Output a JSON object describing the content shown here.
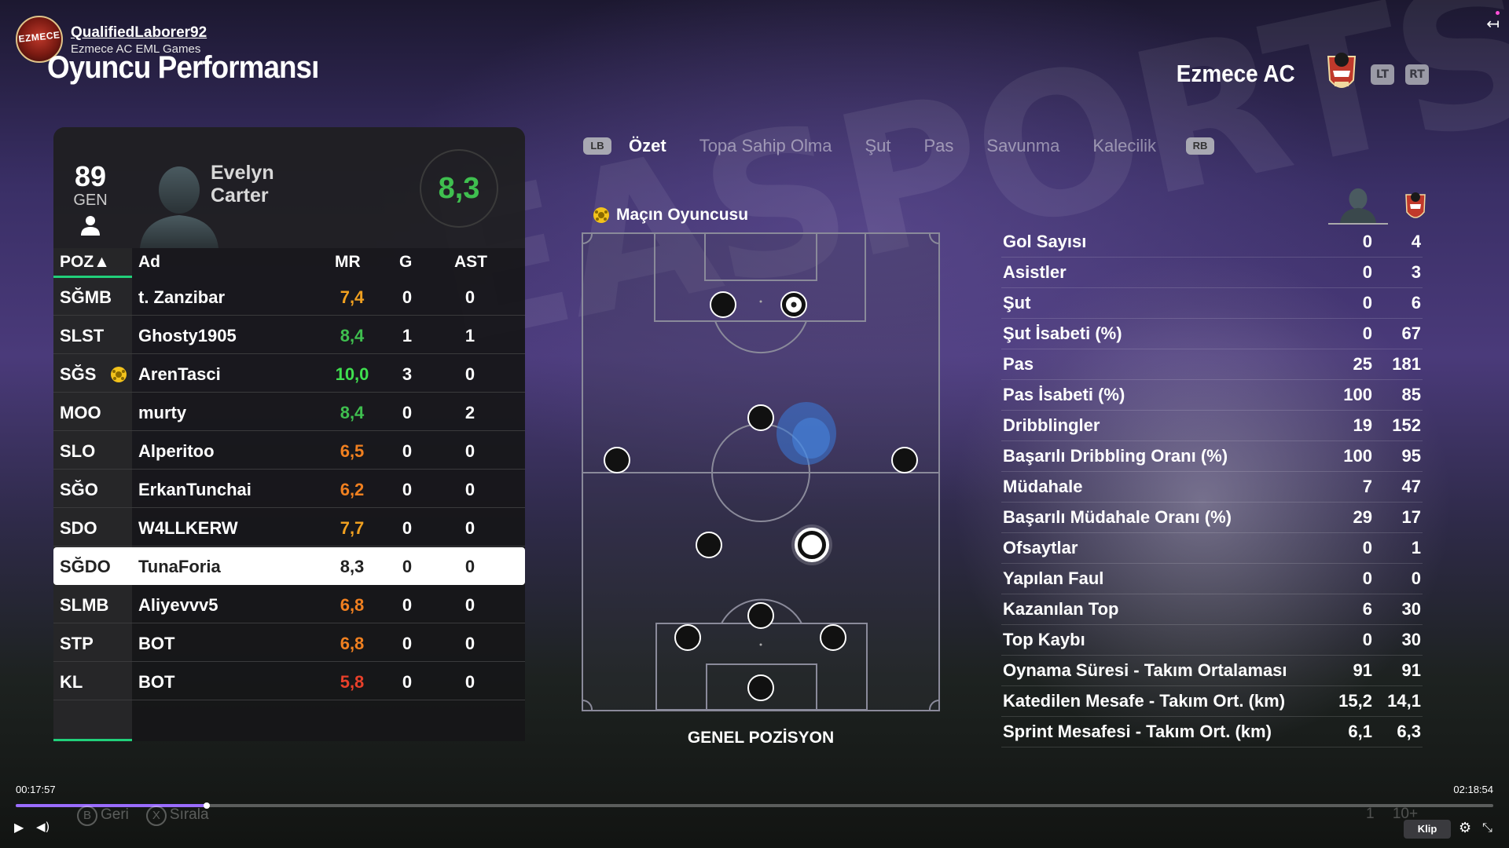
{
  "channel": {
    "logo_text": "EZMECE",
    "name": "QualifiedLaborer92",
    "subtitle": "Ezmece AC EML Games"
  },
  "page_title": "Oyuncu Performansı",
  "team": {
    "name": "Ezmece AC",
    "trigger_left": "LT",
    "trigger_right": "RT"
  },
  "player_card": {
    "overall": "89",
    "overall_label": "GEN",
    "first_name": "Evelyn",
    "last_name": "Carter",
    "match_rating": "8,3",
    "rating_color": "#3fbf4f"
  },
  "table": {
    "headers": {
      "pos": "POZ▲",
      "name": "Ad",
      "mr": "MR",
      "g": "G",
      "ast": "AST"
    },
    "rows": [
      {
        "pos": "SĞMB",
        "name": "t. Zanzibar",
        "mr": "7,4",
        "g": "0",
        "ast": "0",
        "mr_color": "#f0a020"
      },
      {
        "pos": "SLST",
        "name": "Ghosty1905",
        "mr": "8,4",
        "g": "1",
        "ast": "1",
        "mr_color": "#3fbf4f"
      },
      {
        "pos": "SĞS",
        "name": "ArenTasci",
        "mr": "10,0",
        "g": "3",
        "ast": "0",
        "mr_color": "#3fdf4f",
        "motm": true
      },
      {
        "pos": "MOO",
        "name": "murty",
        "mr": "8,4",
        "g": "0",
        "ast": "2",
        "mr_color": "#3fbf4f"
      },
      {
        "pos": "SLO",
        "name": "Alperitoo",
        "mr": "6,5",
        "g": "0",
        "ast": "0",
        "mr_color": "#f08020"
      },
      {
        "pos": "SĞO",
        "name": "ErkanTunchai",
        "mr": "6,2",
        "g": "0",
        "ast": "0",
        "mr_color": "#f08020"
      },
      {
        "pos": "SDO",
        "name": "W4LLKERW",
        "mr": "7,7",
        "g": "0",
        "ast": "0",
        "mr_color": "#f0a020"
      },
      {
        "pos": "SĞDO",
        "name": "TunaForia",
        "mr": "8,3",
        "g": "0",
        "ast": "0",
        "mr_color": "#222222",
        "selected": true
      },
      {
        "pos": "SLMB",
        "name": "Aliyevvv5",
        "mr": "6,8",
        "g": "0",
        "ast": "0",
        "mr_color": "#f08020"
      },
      {
        "pos": "STP",
        "name": "BOT",
        "mr": "6,8",
        "g": "0",
        "ast": "0",
        "mr_color": "#f08020"
      },
      {
        "pos": "KL",
        "name": "BOT",
        "mr": "5,8",
        "g": "0",
        "ast": "0",
        "mr_color": "#e8402a"
      }
    ]
  },
  "tabs": {
    "bumper_left": "LB",
    "bumper_right": "RB",
    "items": [
      "Özet",
      "Topa Sahip Olma",
      "Şut",
      "Pas",
      "Savunma",
      "Kalecilik"
    ],
    "active": "Özet"
  },
  "pitch": {
    "motm_label": "Maçın Oyuncusu",
    "caption": "GENEL POZİSYON"
  },
  "stats": {
    "rows": [
      {
        "label": "Gol Sayısı",
        "player": "0",
        "team": "4"
      },
      {
        "label": "Asistler",
        "player": "0",
        "team": "3"
      },
      {
        "label": "Şut",
        "player": "0",
        "team": "6"
      },
      {
        "label": "Şut İsabeti (%)",
        "player": "0",
        "team": "67"
      },
      {
        "label": "Pas",
        "player": "25",
        "team": "181"
      },
      {
        "label": "Pas İsabeti (%)",
        "player": "100",
        "team": "85"
      },
      {
        "label": "Dribblingler",
        "player": "19",
        "team": "152"
      },
      {
        "label": "Başarılı Dribbling Oranı (%)",
        "player": "100",
        "team": "95"
      },
      {
        "label": "Müdahale",
        "player": "7",
        "team": "47"
      },
      {
        "label": "Başarılı Müdahale Oranı (%)",
        "player": "29",
        "team": "17"
      },
      {
        "label": "Ofsaytlar",
        "player": "0",
        "team": "1"
      },
      {
        "label": "Yapılan Faul",
        "player": "0",
        "team": "0"
      },
      {
        "label": "Kazanılan Top",
        "player": "6",
        "team": "30"
      },
      {
        "label": "Top Kaybı",
        "player": "0",
        "team": "30"
      },
      {
        "label": "Oynama Süresi - Takım Ortalaması",
        "player": "91",
        "team": "91"
      },
      {
        "label": "Katedilen Mesafe - Takım Ort. (km)",
        "player": "15,2",
        "team": "14,1"
      },
      {
        "label": "Sprint Mesafesi - Takım Ort. (km)",
        "player": "6,1",
        "team": "6,3"
      }
    ]
  },
  "video": {
    "current_time": "00:17:57",
    "total_time": "02:18:54",
    "progress": 0.1295,
    "hint_back_key": "B",
    "hint_back": "Geri",
    "hint_sort_key": "X",
    "hint_sort": "Sırala",
    "clip_label": "Klip",
    "faint_count": "10+",
    "faint_num": "1"
  },
  "background_word": "EASPORTS",
  "colors": {
    "accent_green": "#21d07a",
    "progress": "#9a6cff"
  }
}
